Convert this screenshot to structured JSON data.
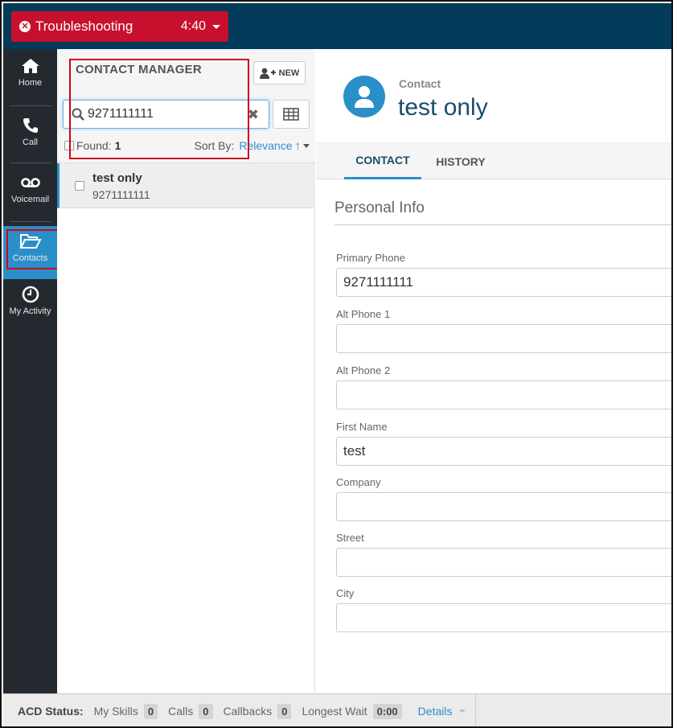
{
  "topbar": {
    "status_label": "Troubleshooting",
    "timer": "4:40",
    "status_color": "#c8102e"
  },
  "sidebar": {
    "items": [
      {
        "label": "Home",
        "icon": "home-icon"
      },
      {
        "label": "Call",
        "icon": "phone-icon"
      },
      {
        "label": "Voicemail",
        "icon": "voicemail-icon"
      },
      {
        "label": "Contacts",
        "icon": "folder-open-icon",
        "active": true
      },
      {
        "label": "My Activity",
        "icon": "clock-icon"
      }
    ]
  },
  "contact_manager": {
    "title": "CONTACT MANAGER",
    "new_label": "NEW",
    "search_value": "9271111111",
    "found_label": "Found:",
    "found_count": "1",
    "sort_label": "Sort By:",
    "sort_value": "Relevance",
    "results": [
      {
        "name": "test only",
        "phone": "9271111111"
      }
    ]
  },
  "detail": {
    "type_label": "Contact",
    "name": "test only",
    "tabs": [
      {
        "label": "CONTACT",
        "active": true
      },
      {
        "label": "HISTORY",
        "active": false
      }
    ],
    "section_title": "Personal Info",
    "fields": [
      {
        "label": "Primary Phone",
        "value": "9271111111"
      },
      {
        "label": "Alt Phone 1",
        "value": ""
      },
      {
        "label": "Alt Phone 2",
        "value": ""
      },
      {
        "label": "First Name",
        "value": "test"
      },
      {
        "label": "Company",
        "value": ""
      },
      {
        "label": "Street",
        "value": ""
      },
      {
        "label": "City",
        "value": ""
      }
    ]
  },
  "statusbar": {
    "acd_label": "ACD Status:",
    "my_skills_label": "My Skills",
    "my_skills_value": "0",
    "calls_label": "Calls",
    "calls_value": "0",
    "callbacks_label": "Callbacks",
    "callbacks_value": "0",
    "longest_wait_label": "Longest Wait",
    "longest_wait_value": "0:00",
    "details_label": "Details"
  },
  "colors": {
    "topbar": "#033c5a",
    "sidebar": "#23292f",
    "accent": "#2a8fc9",
    "highlight_box": "#d0021b"
  }
}
